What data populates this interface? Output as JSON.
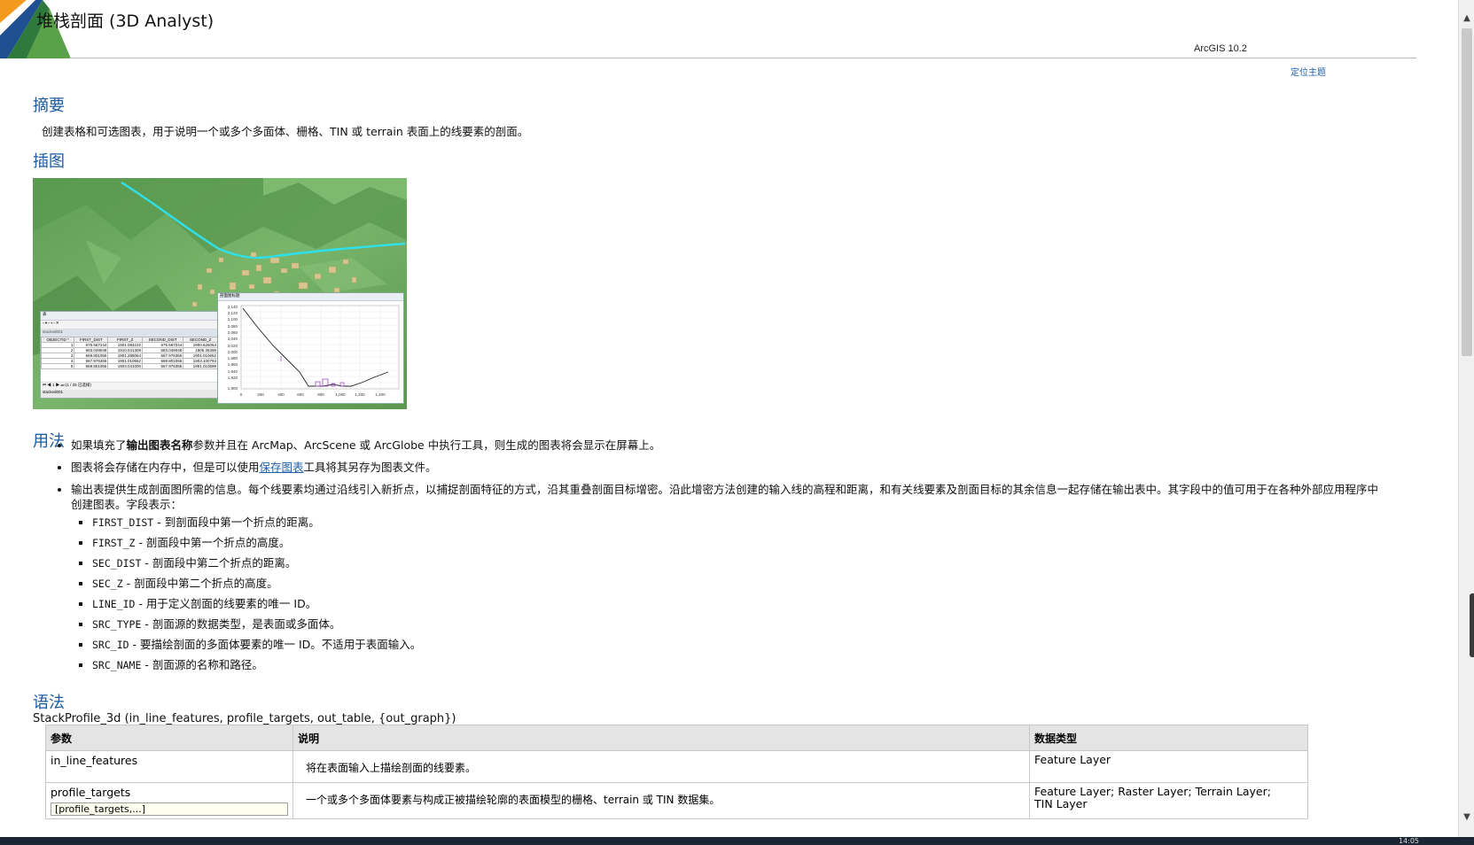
{
  "header": {
    "title": "堆栈剖面 (3D Analyst)",
    "version": "ArcGIS 10.2",
    "locate_topic": "定位主题"
  },
  "sections": {
    "summary": "摘要",
    "illustration": "插图",
    "usage": "用法",
    "syntax": "语法"
  },
  "summary_text": "创建表格和可选图表，用于说明一个或多个多面体、栅格、TIN 或 terrain 表面上的线要素的剖面。",
  "illustration": {
    "table_window": {
      "title": "表",
      "layer_name": "stacked001",
      "columns": [
        "OBJECTID *",
        "FIRST_DIST",
        "FIRST_Z",
        "SECOND_DIST",
        "SECOND_Z"
      ],
      "rows": [
        [
          "1",
          "675.667244",
          "1901.084102",
          "675.667244",
          "1900.626054"
        ],
        [
          "2",
          "683.049048",
          "1910.041308",
          "683.049048",
          "1905.36398"
        ],
        [
          "3",
          "669.801055",
          "1901.288064",
          "667.976355",
          "1901.010652"
        ],
        [
          "4",
          "667.976355",
          "1901.010652",
          "669.801055",
          "1903.100793"
        ],
        [
          "5",
          "669.801055",
          "1903.041000",
          "667.976355",
          "1901.010598"
        ]
      ],
      "record_status": "(1 / 25 已选择)",
      "tab_label": "stacked001"
    },
    "graph_window": {
      "title": "剖面图标题",
      "y_ticks": [
        "2,140",
        "2,120",
        "2,100",
        "2,080",
        "2,060",
        "2,040",
        "2,020",
        "2,000",
        "1,980",
        "1,960",
        "1,940",
        "1,920",
        "1,900"
      ],
      "x_ticks": [
        "0",
        "200",
        "400",
        "600",
        "800",
        "1,000",
        "1,200",
        "1,400"
      ]
    }
  },
  "usage": {
    "item1_pre": "如果填充了",
    "item1_bold": "输出图表名称",
    "item1_post": "参数并且在 ArcMap、ArcScene 或 ArcGlobe 中执行工具，则生成的图表将会显示在屏幕上。",
    "item2_pre": "图表将会存储在内存中，但是可以使用",
    "item2_link": "保存图表",
    "item2_post": "工具将其另存为图表文件。",
    "item3_line1": "输出表提供生成剖面图所需的信息。每个线要素均通过沿线引入新折点，以捕捉剖面特征的方式，沿其重叠剖面目标增密。沿此增密方法创建的输入线的高程和距离，和有关线要素及剖面目标的其余信息一起存储在输出表中。其字段中的值可用于在各种外部应用程序中",
    "item3_line2": "创建图表。字段表示：",
    "fields": [
      {
        "name": "FIRST_DIST",
        "desc": " - 到剖面段中第一个折点的距离。"
      },
      {
        "name": "FIRST_Z",
        "desc": " - 剖面段中第一个折点的高度。"
      },
      {
        "name": "SEC_DIST",
        "desc": " - 剖面段中第二个折点的距离。"
      },
      {
        "name": "SEC_Z",
        "desc": " - 剖面段中第二个折点的高度。"
      },
      {
        "name": "LINE_ID",
        "desc": " - 用于定义剖面的线要素的唯一 ID。"
      },
      {
        "name": "SRC_TYPE",
        "desc": " - 剖面源的数据类型，是表面或多面体。"
      },
      {
        "name": "SRC_ID",
        "desc": " - 要描绘剖面的多面体要素的唯一 ID。不适用于表面输入。"
      },
      {
        "name": "SRC_NAME",
        "desc": " - 剖面源的名称和路径。"
      }
    ]
  },
  "syntax": {
    "signature": "StackProfile_3d (in_line_features, profile_targets, out_table, {out_graph})",
    "table_headers": [
      "参数",
      "说明",
      "数据类型"
    ],
    "rows": [
      {
        "param": "in_line_features",
        "desc": "将在表面输入上描绘剖面的线要素。",
        "dtype_1": "Feature Layer",
        "dtype_2": ""
      },
      {
        "param": "profile_targets",
        "input_value": "[profile_targets,...]",
        "desc": "一个或多个多面体要素与构成正被描绘轮廓的表面模型的栅格、terrain 或 TIN 数据集。",
        "dtype_1": "Feature Layer; Raster Layer; Terrain Layer;",
        "dtype_2": "TIN Layer"
      }
    ]
  },
  "taskbar": {
    "clock": "14:05"
  },
  "colors": {
    "heading": "#1b5a9e",
    "link": "#1f5fa8",
    "terrain": "#6aa65f",
    "profile_line": "#2fe0e8",
    "buildings": "#d9c38e"
  }
}
